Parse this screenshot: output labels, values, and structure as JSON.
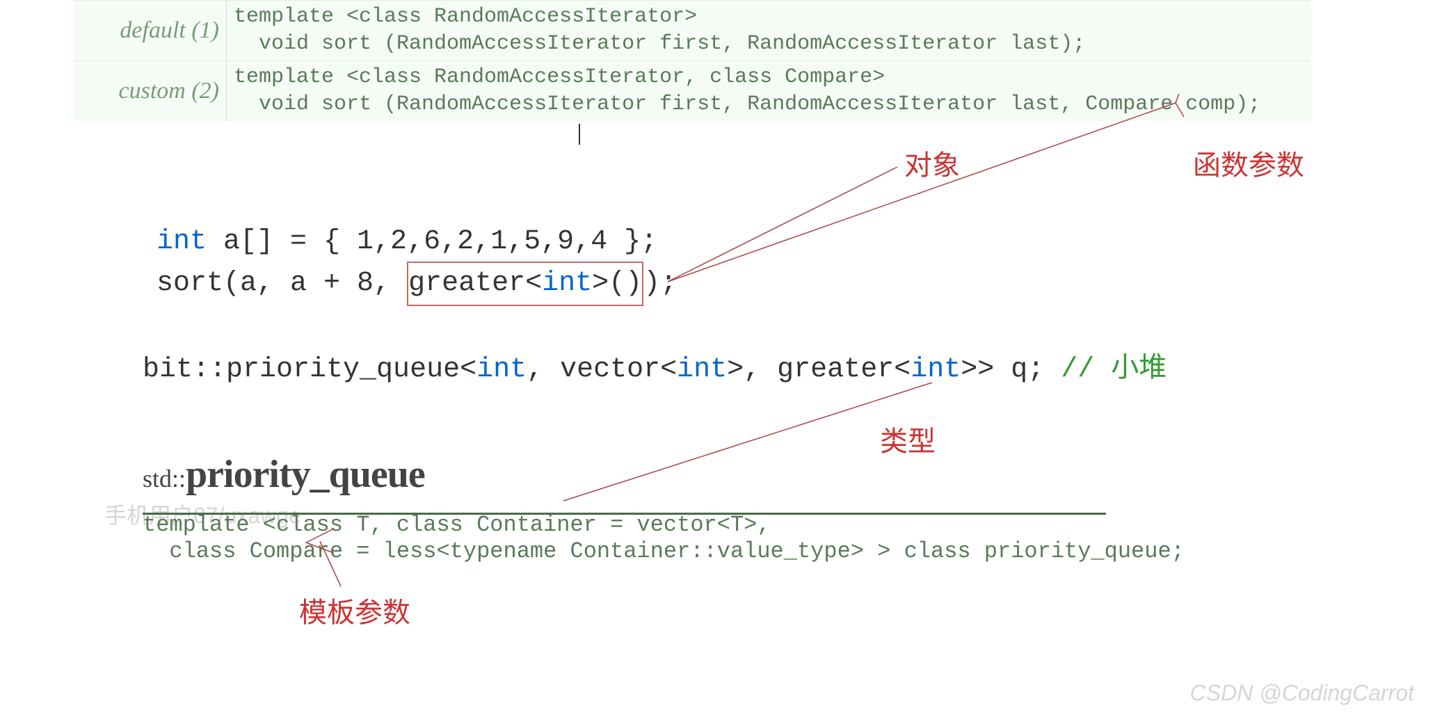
{
  "sort_table": {
    "default_label": "default (1)",
    "default_code": "template <class RandomAccessIterator>\n  void sort (RandomAccessIterator first, RandomAccessIterator last);",
    "custom_label": "custom (2)",
    "custom_code": "template <class RandomAccessIterator, class Compare>\n  void sort (RandomAccessIterator first, RandomAccessIterator last, Compare comp);"
  },
  "annotations": {
    "object": "对象",
    "func_param": "函数参数",
    "type": "类型",
    "template_param": "模板参数"
  },
  "code1": {
    "int_kw": "int",
    "arr_decl": " a[] = { 1,2,6,2,1,5,9,4 };",
    "sort_call_pre": "sort(a, a + 8, ",
    "greater_part1": "greater<",
    "int_kw2": "int",
    "greater_part2": ">()",
    "sort_call_post": ");"
  },
  "code2": {
    "prefix": "bit::priority_queue<",
    "t_int": "int",
    "mid1": ", vector<",
    "t_int2": "int",
    "mid2": ">, greater<",
    "t_int3": "int",
    "mid3": ">> q; ",
    "comment": "// 小堆"
  },
  "pq": {
    "ns": "std::",
    "name": "priority_queue",
    "template": "template <class T, class Container = vector<T>,\n  class Compare = less<typename Container::value_type> > class priority_queue;"
  },
  "watermarks": {
    "user": "手机用户07/uxawge",
    "csdn": "CSDN @CodingCarrot"
  }
}
